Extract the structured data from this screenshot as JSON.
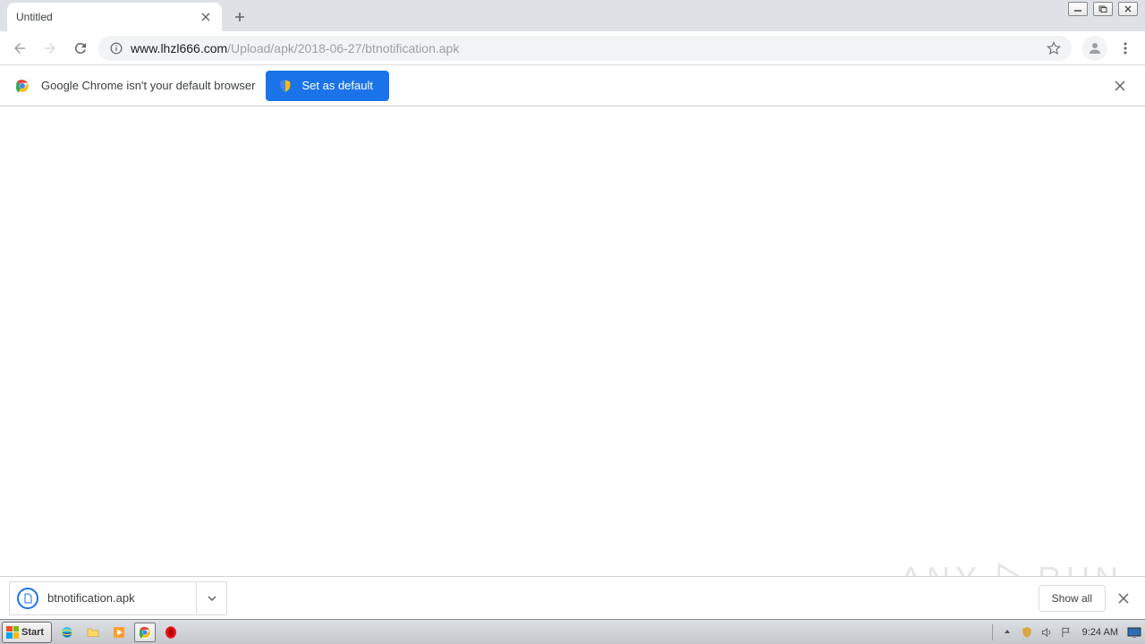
{
  "tab": {
    "title": "Untitled"
  },
  "url": {
    "domain": "www.lhzl666.com",
    "path": "/Upload/apk/2018-06-27/btnotification.apk"
  },
  "infobar": {
    "message": "Google Chrome isn't your default browser",
    "button": "Set as default"
  },
  "download": {
    "filename": "btnotification.apk",
    "showall": "Show all"
  },
  "taskbar": {
    "start": "Start",
    "clock": "9:24 AM"
  },
  "watermark": {
    "left": "ANY",
    "right": "RUN"
  }
}
